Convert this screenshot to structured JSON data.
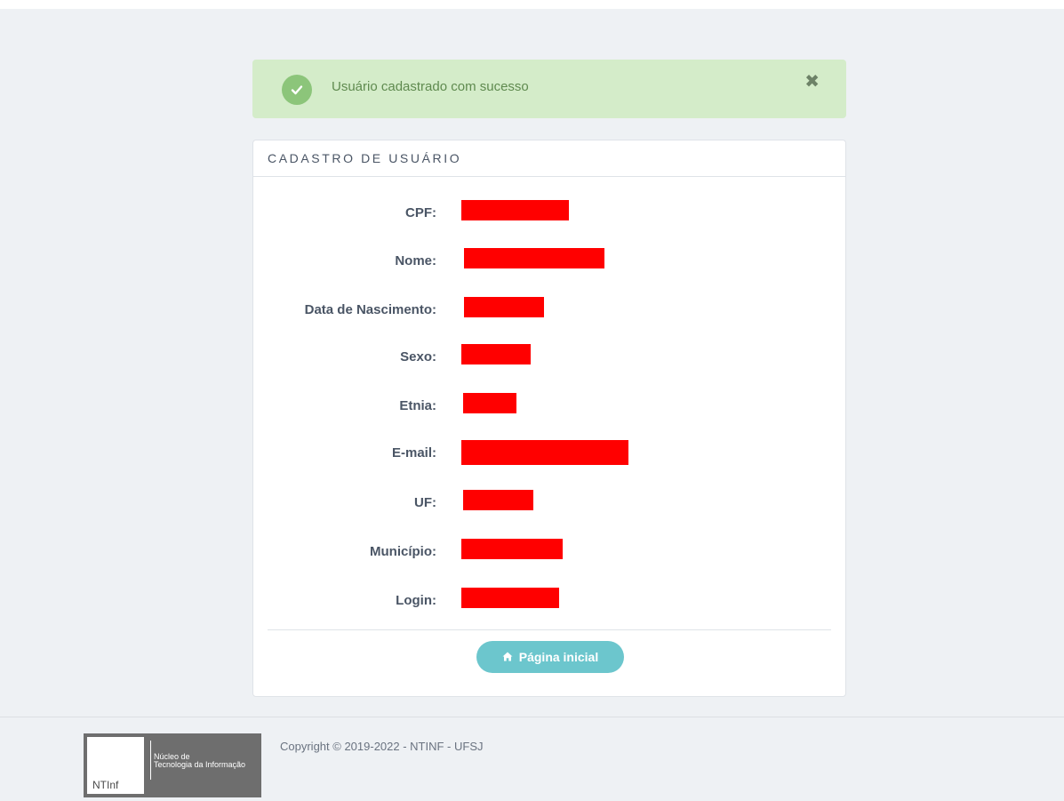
{
  "alert": {
    "message": "Usuário cadastrado com sucesso",
    "close_glyph": "✖",
    "icon": "check-circle-icon",
    "color": "#d4ecc9"
  },
  "panel": {
    "title": "CADASTRO DE USUÁRIO",
    "fields": [
      {
        "label": "CPF:"
      },
      {
        "label": "Nome:"
      },
      {
        "label": "Data de Nascimento:"
      },
      {
        "label": "Sexo:"
      },
      {
        "label": "Etnia:"
      },
      {
        "label": "E-mail:"
      },
      {
        "label": "UF:"
      },
      {
        "label": "Município:"
      },
      {
        "label": "Login:"
      }
    ],
    "redaction_color": "#ff0000",
    "home_button": {
      "label": "Página inicial",
      "icon": "home-icon",
      "color": "#6cc6cd"
    }
  },
  "footer": {
    "logo": {
      "abbr": "NTInf",
      "line1": "Núcleo de",
      "line2": "Tecnologia da Informação"
    },
    "copyright": "Copyright © 2019-2022 - NTINF - UFSJ"
  }
}
